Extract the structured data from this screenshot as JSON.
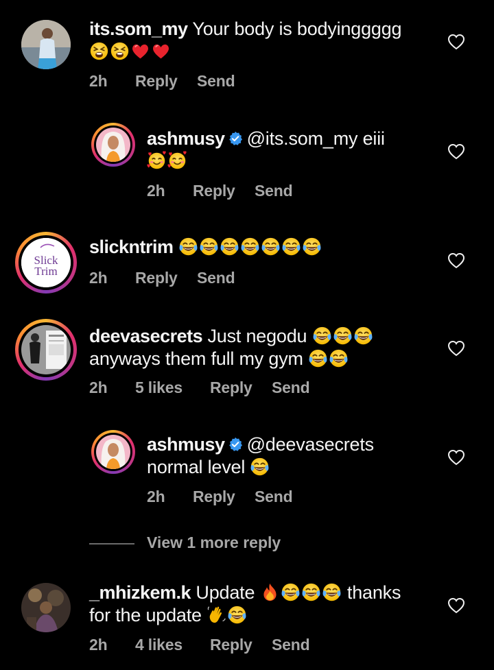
{
  "comments": [
    {
      "username": "its.som_my",
      "text": "Your body is bodyinggggg",
      "emojis": [
        "weary-face",
        "weary-face",
        "red-heart",
        "red-heart"
      ],
      "time": "2h",
      "likes": "",
      "reply_label": "Reply",
      "send_label": "Send"
    },
    {
      "username": "ashmusy",
      "verified": true,
      "text": "@its.som_my eiii",
      "emojis": [
        "smiling-face-with-hearts",
        "smiling-face-with-hearts"
      ],
      "time": "2h",
      "reply_label": "Reply",
      "send_label": "Send"
    },
    {
      "username": "slickntrim",
      "text": "",
      "emojis": [
        "tears-of-joy",
        "tears-of-joy",
        "tears-of-joy",
        "tears-of-joy",
        "tears-of-joy",
        "tears-of-joy",
        "tears-of-joy"
      ],
      "avatar_text_line1": "Slick",
      "avatar_text_line2": "Trim",
      "time": "2h",
      "reply_label": "Reply",
      "send_label": "Send"
    },
    {
      "username": "deevasecrets",
      "text": "Just negodu",
      "emojis": [
        "tears-of-joy",
        "tears-of-joy",
        "tears-of-joy"
      ],
      "text2": "anyways them full my gym",
      "emojis2": [
        "tears-of-joy",
        "tears-of-joy"
      ],
      "time": "2h",
      "likes": "5 likes",
      "reply_label": "Reply",
      "send_label": "Send"
    },
    {
      "username": "ashmusy",
      "verified": true,
      "text": "@deevasecrets",
      "text2": "normal level",
      "emojis2": [
        "tears-of-joy"
      ],
      "time": "2h",
      "reply_label": "Reply",
      "send_label": "Send"
    },
    {
      "username": "_mhizkem.k",
      "text": "Update",
      "emojis": [
        "fire",
        "tears-of-joy",
        "tears-of-joy",
        "tears-of-joy"
      ],
      "text_after": "thanks",
      "text2": "for the update",
      "emojis2": [
        "waving-hand",
        "tears-of-joy"
      ],
      "time": "2h",
      "likes": "4 likes",
      "reply_label": "Reply",
      "send_label": "Send"
    }
  ],
  "view_more_label": "View 1 more reply",
  "colors": {
    "background": "#000000",
    "text": "#f5f5f5",
    "meta": "#a8a8a8",
    "verified": "#3897f0"
  },
  "icons": {
    "heart": "heart-outline-icon",
    "verified": "verified-badge-icon"
  }
}
